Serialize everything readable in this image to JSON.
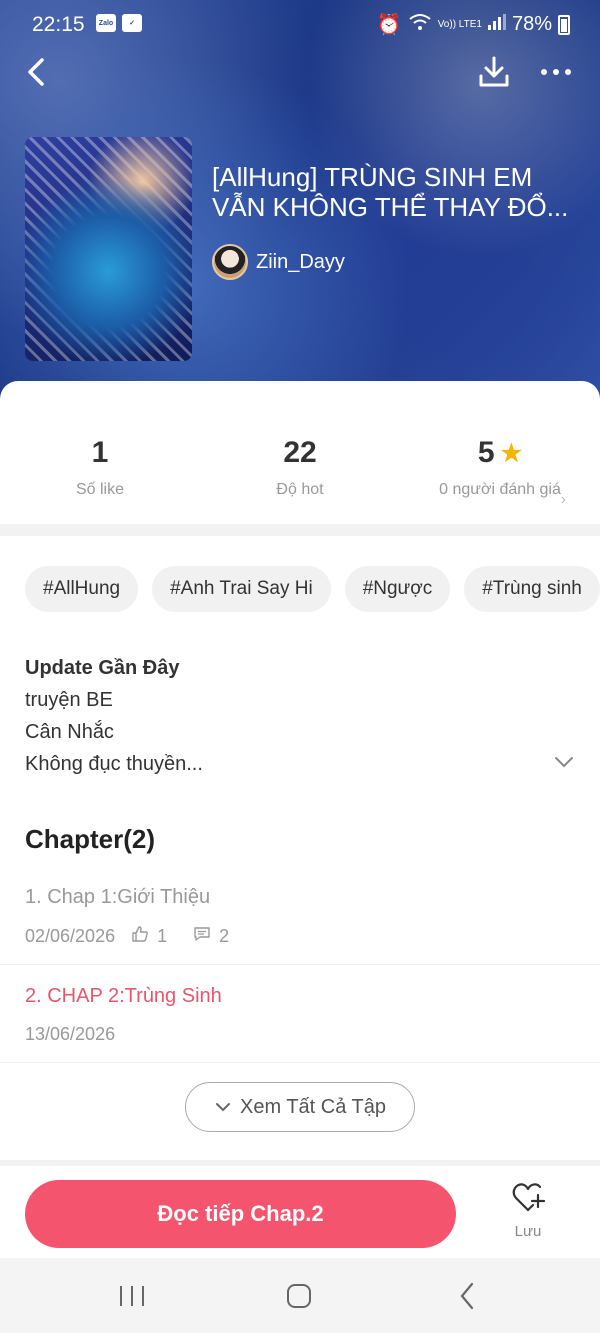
{
  "status": {
    "time": "22:15",
    "app_icon_text": "Zalo",
    "battery": "78%",
    "network": "Vo)) LTE1"
  },
  "story": {
    "title": "[AllHung] TRÙNG SINH EM VẪN KHÔNG THỂ THAY ĐỔ...",
    "author": "Ziin_Dayy"
  },
  "stats": [
    {
      "value": "1",
      "label": "Số like"
    },
    {
      "value": "22",
      "label": "Độ hot"
    },
    {
      "value": "5",
      "label": "0 người đánh giá"
    }
  ],
  "tags": [
    "#AllHung",
    "#Anh Trai Say Hi",
    "#Ngược",
    "#Trùng sinh"
  ],
  "description": {
    "title": "Update Gần Đây",
    "lines": [
      "truyện BE",
      "Cân Nhắc",
      "Không đục thuyền..."
    ]
  },
  "chapters_heading": "Chapter(2)",
  "chapters": [
    {
      "title": "1. Chap 1:Giới Thiệu",
      "date": "02/06/2026",
      "likes": "1",
      "comments": "2",
      "color": "#999999"
    },
    {
      "title": "2. CHAP 2:Trùng Sinh",
      "date": "13/06/2026",
      "color": "#e8556d"
    }
  ],
  "view_all_label": "Xem Tất Cả Tập",
  "read_button_label": "Đọc tiếp Chap.2",
  "save_label": "Lưu",
  "colors": {
    "accent": "#f4546d",
    "star": "#f5b400"
  }
}
